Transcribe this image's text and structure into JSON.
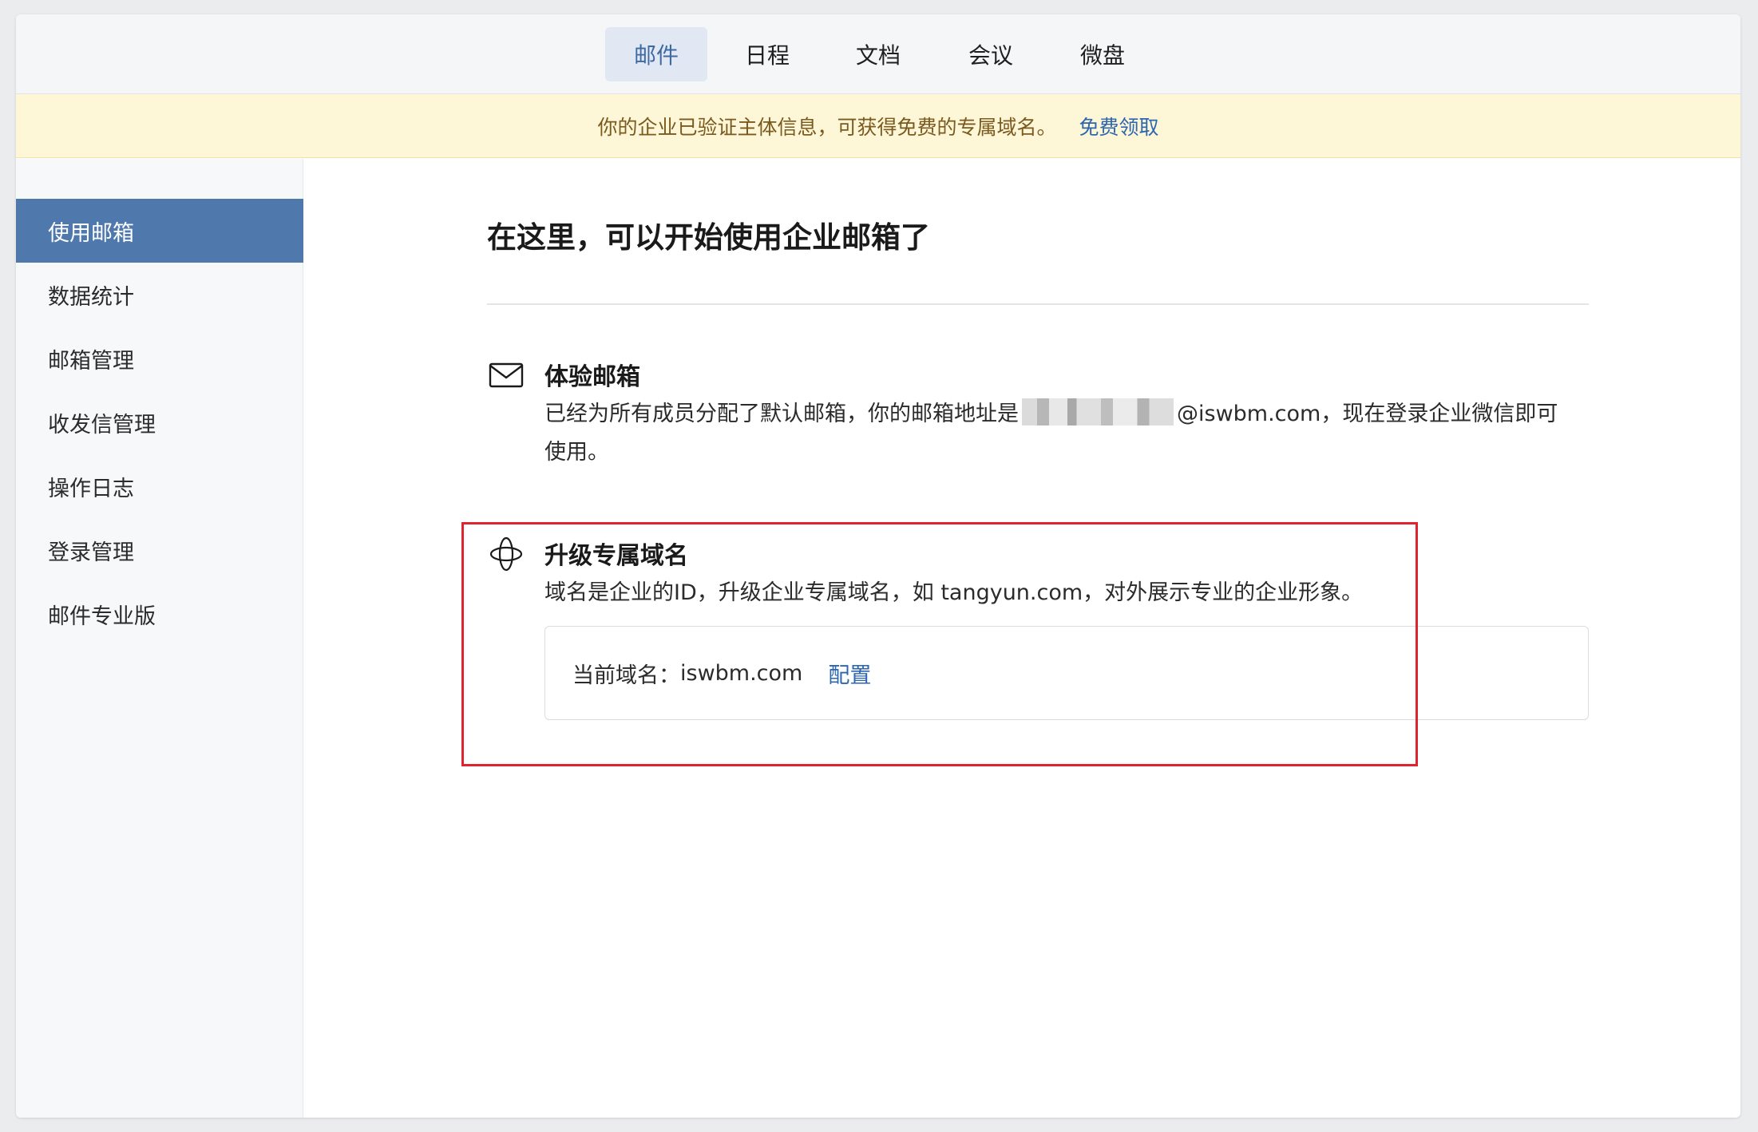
{
  "nav": {
    "tabs": [
      {
        "label": "邮件",
        "active": true
      },
      {
        "label": "日程",
        "active": false
      },
      {
        "label": "文档",
        "active": false
      },
      {
        "label": "会议",
        "active": false
      },
      {
        "label": "微盘",
        "active": false
      }
    ]
  },
  "banner": {
    "text": "你的企业已验证主体信息，可获得免费的专属域名。",
    "link": "免费领取"
  },
  "sidebar": {
    "items": [
      {
        "label": "使用邮箱",
        "active": true
      },
      {
        "label": "数据统计"
      },
      {
        "label": "邮箱管理"
      },
      {
        "label": "收发信管理"
      },
      {
        "label": "操作日志"
      },
      {
        "label": "登录管理"
      },
      {
        "label": "邮件专业版"
      }
    ]
  },
  "main": {
    "title": "在这里，可以开始使用企业邮箱了",
    "trial": {
      "icon": "mail-icon",
      "title": "体验邮箱",
      "desc_before": "已经为所有成员分配了默认邮箱，你的邮箱地址是",
      "desc_after": "@iswbm.com，现在登录企业微信即可",
      "desc_line2": "使用。"
    },
    "domain": {
      "icon": "domain-orbit-icon",
      "title": "升级专属域名",
      "desc": "域名是企业的ID，升级企业专属域名，如 tangyun.com，对外展示专业的企业形象。",
      "current_label": "当前域名：",
      "current_value": "iswbm.com",
      "config_link": "配置"
    }
  },
  "colors": {
    "accent": "#4f79ac",
    "link": "#2d66b0",
    "banner_bg": "#fdf6d7",
    "highlight": "#e0242f"
  }
}
